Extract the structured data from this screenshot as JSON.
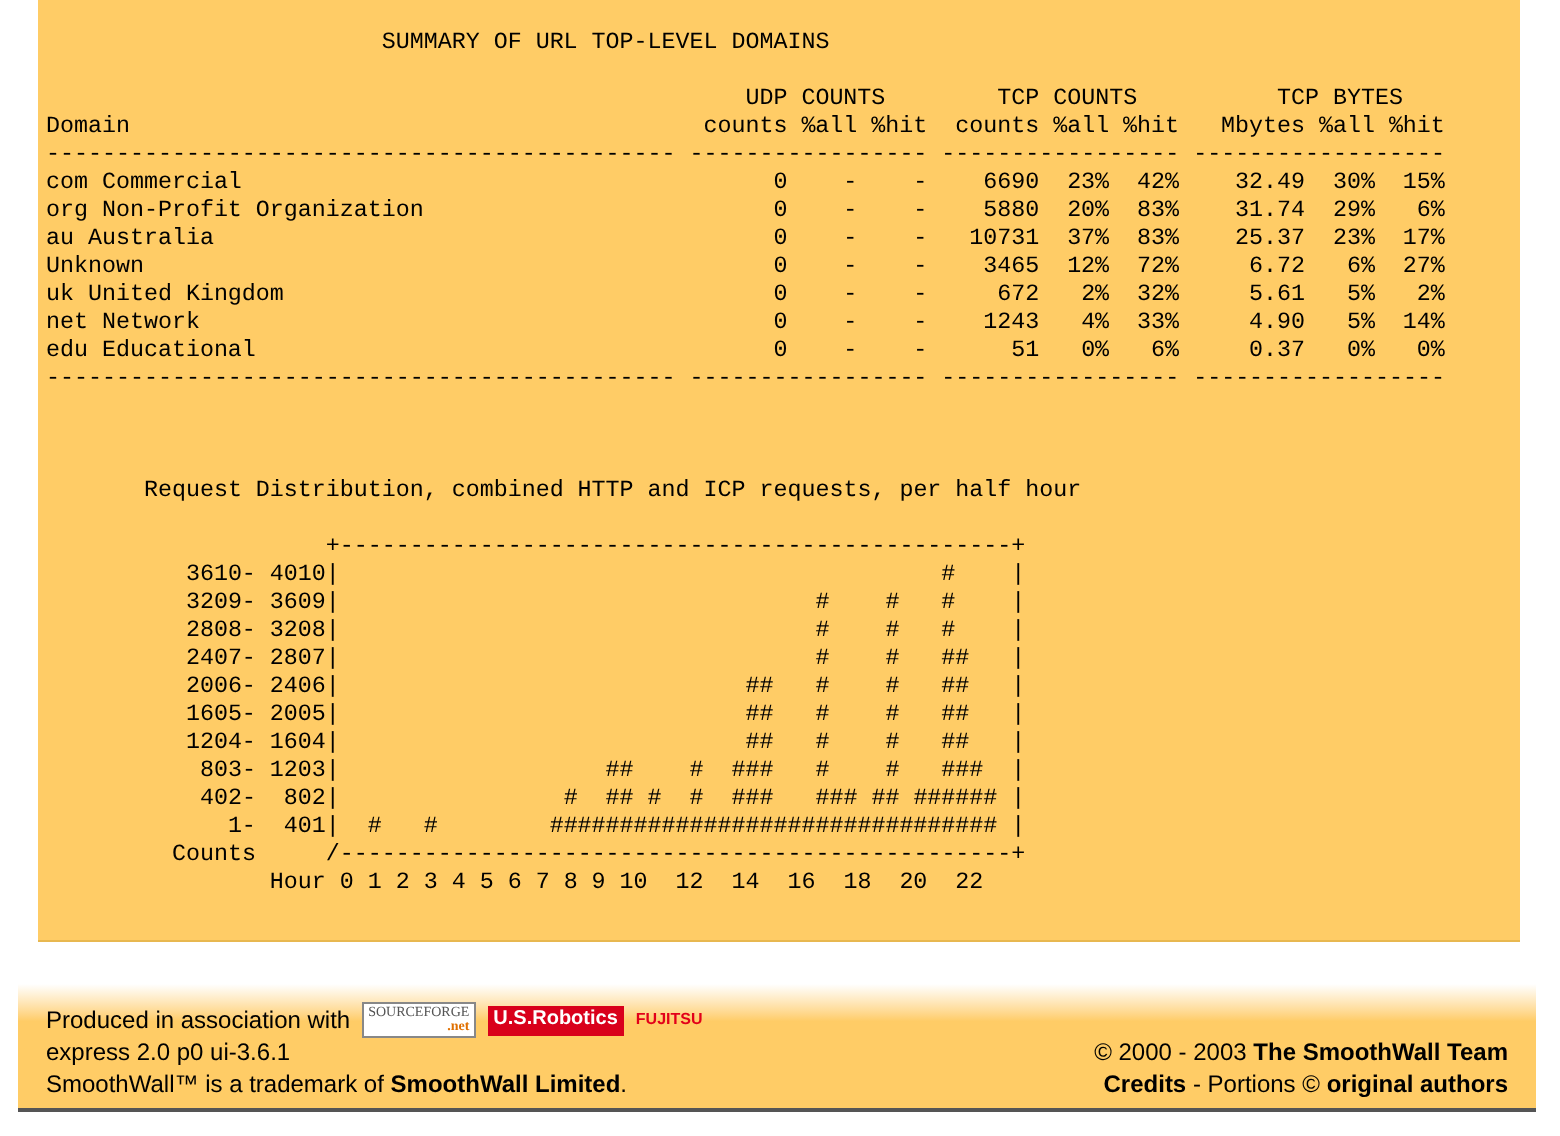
{
  "report": {
    "title": "SUMMARY OF URL TOP-LEVEL DOMAINS",
    "column_groups": [
      "UDP COUNTS",
      "TCP COUNTS",
      "TCP BYTES"
    ],
    "columns": [
      "Domain",
      "counts",
      "%all",
      "%hit",
      "counts",
      "%all",
      "%hit",
      "Mbytes",
      "%all",
      "%hit"
    ],
    "rule_top": "--------------------------------------------- ----------------- ----------------- ------------------",
    "rows": [
      {
        "cells": [
          "com Commercial",
          "0",
          "-",
          "-",
          "6690",
          "23%",
          "42%",
          "32.49",
          "30%",
          "15%"
        ]
      },
      {
        "cells": [
          "org Non-Profit Organization",
          "0",
          "-",
          "-",
          "5880",
          "20%",
          "83%",
          "31.74",
          "29%",
          "6%"
        ]
      },
      {
        "cells": [
          "au Australia",
          "0",
          "-",
          "-",
          "10731",
          "37%",
          "83%",
          "25.37",
          "23%",
          "17%"
        ]
      },
      {
        "cells": [
          "Unknown",
          "0",
          "-",
          "-",
          "3465",
          "12%",
          "72%",
          "6.72",
          "6%",
          "27%"
        ]
      },
      {
        "cells": [
          "uk United Kingdom",
          "0",
          "-",
          "-",
          "672",
          "2%",
          "32%",
          "5.61",
          "5%",
          "2%"
        ]
      },
      {
        "cells": [
          "net Network",
          "0",
          "-",
          "-",
          "1243",
          "4%",
          "33%",
          "4.90",
          "5%",
          "14%"
        ]
      },
      {
        "cells": [
          "edu Educational",
          "0",
          "-",
          "-",
          "51",
          "0%",
          "6%",
          "0.37",
          "0%",
          "0%"
        ]
      }
    ],
    "rule_bottom": "--------------------------------------------- ----------------- ----------------- ------------------"
  },
  "histogram": {
    "lines": [
      "       Request Distribution, combined HTTP and ICP requests, per half hour",
      "                    +------------------------------------------------+",
      "          3610- 4010|                                           #    |",
      "          3209- 3609|                                  #    #   #    |",
      "          2808- 3208|                                  #    #   #    |",
      "          2407- 2807|                                  #    #   ##   |",
      "          2006- 2406|                             ##   #    #   ##   |",
      "          1605- 2005|                             ##   #    #   ##   |",
      "          1204- 1604|                             ##   #    #   ##   |",
      "           803- 1203|                   ##    #  ###   #    #   ###  |",
      "           402-  802|                #  ## #  #  ###   ### ## ###### |",
      "             1-  401|  #   #        ################################ |",
      "         Counts     /------------------------------------------------+",
      "                Hour 0 1 2 3 4 5 6 7 8 9 10  12  14  16  18  20  22"
    ]
  },
  "footer": {
    "association": "Produced in association with",
    "logos": [
      {
        "kind": "sourceforge",
        "texts": [
          "SOURCEFORGE",
          ".net"
        ]
      },
      {
        "kind": "usrobotics",
        "texts": [
          "U.S.Robotics"
        ]
      },
      {
        "kind": "fujitsu",
        "texts": [
          "FUJITSU"
        ]
      }
    ],
    "version": "express 2.0 p0 ui-3.6.1",
    "trademark": "SmoothWall™ is a trademark of **SmoothWall Limited**.",
    "copyright": "© 2000 - 2003 **The SmoothWall Team**",
    "credits": "**Credits** - Portions © **original authors**"
  }
}
